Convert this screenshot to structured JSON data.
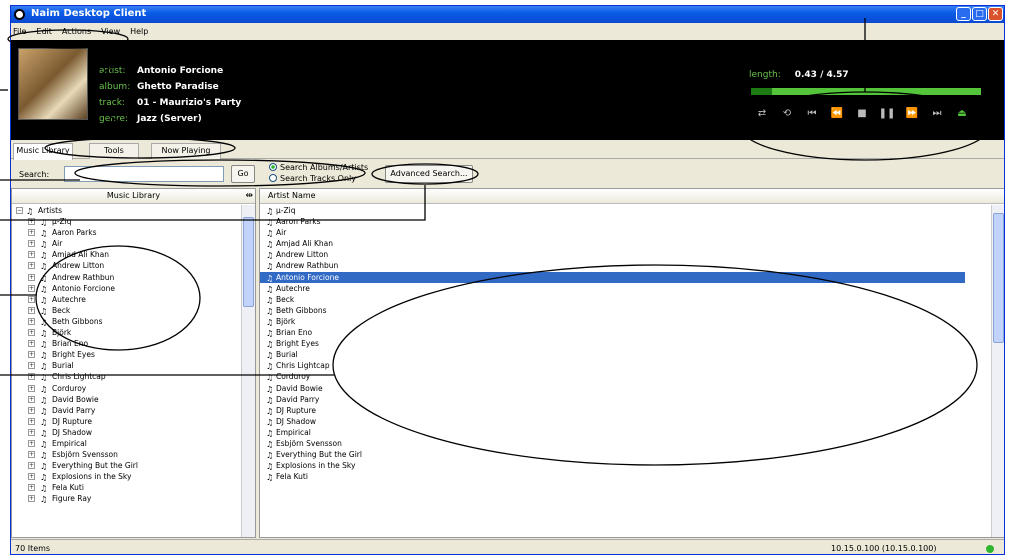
{
  "window": {
    "title": "Naim Desktop Client"
  },
  "menu": {
    "items": [
      "File",
      "Edit",
      "Actions",
      "View",
      "Help"
    ]
  },
  "now_playing": {
    "artist_label": "artist:",
    "artist": "Antonio Forcione",
    "album_label": "album:",
    "album": "Ghetto Paradise",
    "track_label": "track:",
    "track": "01 - Maurizio's Party",
    "genre_label": "genre:",
    "genre": "Jazz (Server)",
    "length_label": "length:",
    "length": "0.43 / 4.57",
    "progress_fraction": 0.09
  },
  "controls": [
    "shuffle-icon",
    "repeat-icon",
    "first-icon",
    "rewind-icon",
    "stop-icon",
    "pause-icon",
    "fast-forward-icon",
    "last-icon",
    "eject-icon"
  ],
  "tabs": [
    "Music Library",
    "Tools",
    "Now Playing"
  ],
  "search": {
    "label": "Search:",
    "go": "Go",
    "radio_albums": "Search Albums/Artists",
    "radio_tracks": "Search Tracks Only",
    "advanced": "Advanced Search..."
  },
  "library": {
    "header": "Music Library",
    "root": "Artists",
    "artists": [
      "µ-Ziq",
      "Aaron Parks",
      "Air",
      "Amjad Ali Khan",
      "Andrew Litton",
      "Andrew Rathbun",
      "Antonio Forcione",
      "Autechre",
      "Beck",
      "Beth Gibbons",
      "Björk",
      "Brian Eno",
      "Bright Eyes",
      "Burial",
      "Chris Lightcap",
      "Corduroy",
      "David Bowie",
      "David Parry",
      "DJ Rupture",
      "DJ Shadow",
      "Empirical",
      "Esbjörn Svensson",
      "Everything But the Girl",
      "Explosions in the Sky",
      "Fela Kuti",
      "Figure Ray"
    ]
  },
  "artist_list": {
    "header": "Artist Name",
    "selected": "Antonio Forcione",
    "items": [
      "µ-Ziq",
      "Aaron Parks",
      "Air",
      "Amjad Ali Khan",
      "Andrew Litton",
      "Andrew Rathbun",
      "Antonio Forcione",
      "Autechre",
      "Beck",
      "Beth Gibbons",
      "Björk",
      "Brian Eno",
      "Bright Eyes",
      "Burial",
      "Chris Lightcap",
      "Corduroy",
      "David Bowie",
      "David Parry",
      "DJ Rupture",
      "DJ Shadow",
      "Empirical",
      "Esbjörn Svensson",
      "Everything But the Girl",
      "Explosions in the Sky",
      "Fela Kuti"
    ]
  },
  "status": {
    "count": "70 Items",
    "host": "10.15.0.100 (10.15.0.100)"
  },
  "colors": {
    "accent_green": "#54c43a",
    "selection_blue": "#316ac5",
    "title_blue": "#0a5ce8"
  }
}
